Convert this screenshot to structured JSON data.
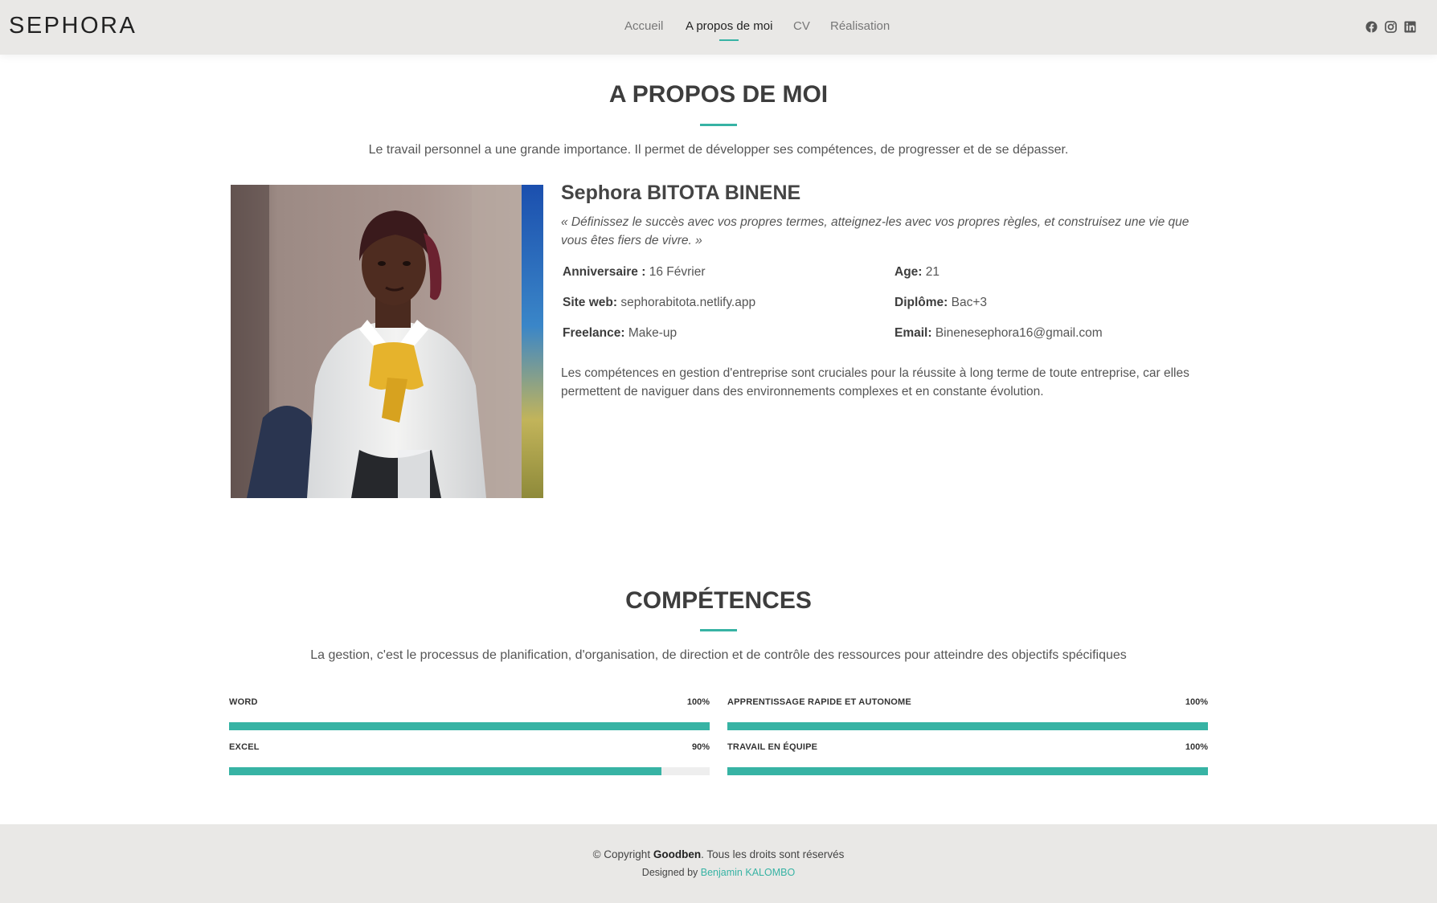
{
  "header": {
    "logo": "SEPHORA",
    "nav": [
      {
        "label": "Accueil",
        "active": false
      },
      {
        "label": "A propos de moi",
        "active": true
      },
      {
        "label": "CV",
        "active": false
      },
      {
        "label": "Réalisation",
        "active": false
      }
    ],
    "social_icons": [
      "facebook-icon",
      "instagram-icon",
      "linkedin-icon"
    ]
  },
  "about": {
    "title": "A PROPOS DE MOI",
    "intro": "Le travail personnel a une grande importance. Il permet de développer ses compétences, de progresser et de se dépasser.",
    "name": "Sephora BITOTA BINENE",
    "quote": "« Définissez le succès avec vos propres termes, atteignez-les avec vos propres règles, et construisez une vie que vous êtes fiers de vivre. »",
    "info": {
      "birthday": {
        "label": "Anniversaire :",
        "value": "16 Février"
      },
      "website": {
        "label": "Site web:",
        "value": "sephorabitota.netlify.app"
      },
      "freelance": {
        "label": "Freelance:",
        "value": "Make-up"
      },
      "age": {
        "label": "Age:",
        "value": "21"
      },
      "degree": {
        "label": "Diplôme:",
        "value": "Bac+3"
      },
      "email": {
        "label": "Email:",
        "value": "Binenesephora16@gmail.com"
      }
    },
    "paragraph": "Les compétences en gestion d'entreprise sont cruciales pour la réussite à long terme de toute entreprise, car elles permettent de naviguer dans des environnements complexes et en constante évolution."
  },
  "skills": {
    "title": "COMPÉTENCES",
    "intro": "La gestion, c'est le processus de planification, d'organisation, de direction et de contrôle des ressources pour atteindre des objectifs spécifiques",
    "items": [
      {
        "label": "WORD",
        "value_text": "100%",
        "percent": 100
      },
      {
        "label": "APPRENTISSAGE RAPIDE ET AUTONOME",
        "value_text": "100%",
        "percent": 100
      },
      {
        "label": "EXCEL",
        "value_text": "90%",
        "percent": 90
      },
      {
        "label": "TRAVAIL EN ÉQUIPE",
        "value_text": "100%",
        "percent": 100
      }
    ]
  },
  "footer": {
    "copyright_prefix": "© Copyright ",
    "copyright_brand": "Goodben",
    "copyright_suffix": ". Tous les droits sont réservés",
    "designed_prefix": "Designed by ",
    "designer": "Benjamin KALOMBO"
  },
  "colors": {
    "accent": "#37b3a4",
    "header_bg": "#e9e8e6",
    "footer_bg": "#e9e8e6",
    "text": "#444444"
  }
}
